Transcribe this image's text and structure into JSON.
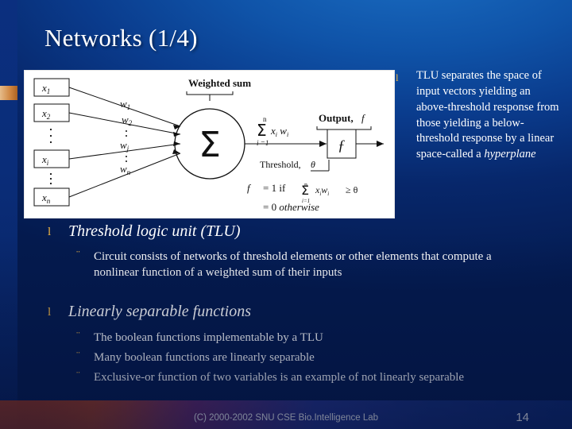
{
  "slide": {
    "title": "Networks (1/4)",
    "page_number": "14",
    "footer": "(C) 2000-2002 SNU CSE Bio.Intelligence Lab"
  },
  "right_note": {
    "bullet_glyph": "l",
    "text_part1": "TLU separates the space of input vectors yielding an above-threshold response from those yielding a below-threshold response by a linear space-called a ",
    "text_italic": "hyperplane"
  },
  "body": {
    "items": [
      {
        "bullet_glyph": "l",
        "label": "Threshold logic unit (TLU)",
        "subitems": [
          {
            "bullet_glyph": "¨",
            "text": "Circuit consists of networks of threshold elements or other elements that compute  a nonlinear function of a weighted sum of their inputs"
          }
        ]
      },
      {
        "bullet_glyph": "l",
        "label": "Linearly separable functions",
        "subitems": [
          {
            "bullet_glyph": "¨",
            "text": "The boolean functions implementable by a TLU"
          },
          {
            "bullet_glyph": "¨",
            "text": "Many boolean functions are linearly separable"
          },
          {
            "bullet_glyph": "¨",
            "text": "Exclusive-or function of two variables is an example of not linearly separable"
          }
        ]
      }
    ]
  },
  "figure": {
    "inputs": [
      "x",
      "x",
      "x",
      "x"
    ],
    "input_subscripts": [
      "1",
      "2",
      "i",
      "n"
    ],
    "weights": [
      "w",
      "w",
      "w",
      "w"
    ],
    "weight_subscripts": [
      "1",
      "2",
      "j",
      "n"
    ],
    "weighted_sum_label": "Weighted sum",
    "sum_symbol": "S",
    "sum_expression_top": "n",
    "sum_expression_body": "x  w",
    "sum_expression_sub": "i",
    "sum_expression_bottom": "i =1",
    "output_label": "Output, f",
    "threshold_label": "Threshold, q",
    "equation_line1": "f  =  1  if",
    "equation_line1b": "x w   ³  q",
    "equation_line2": "=  0  otherwise",
    "f_box_label": "f",
    "dots": "..."
  },
  "colors": {
    "accent_bullet": "#f5b942",
    "text": "#ffffff",
    "background_deep": "#041a4e",
    "background_light": "#1b6fc4"
  }
}
